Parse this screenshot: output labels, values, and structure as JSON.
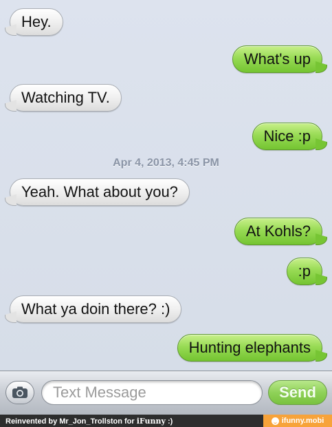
{
  "messages": [
    {
      "dir": "in",
      "text": "Hey."
    },
    {
      "dir": "out",
      "text": "What's up"
    },
    {
      "dir": "in",
      "text": "Watching TV."
    },
    {
      "dir": "out",
      "text": "Nice :p"
    },
    {
      "dir": "in",
      "text": "Yeah. What about you?"
    },
    {
      "dir": "out",
      "text": "At Kohls?"
    },
    {
      "dir": "out",
      "text": ":p"
    },
    {
      "dir": "in",
      "text": "What ya doin there? :)"
    },
    {
      "dir": "out",
      "text": "Hunting elephants"
    }
  ],
  "timestamp": "Apr 4, 2013, 4:45 PM",
  "input": {
    "placeholder": "Text Message",
    "value": "",
    "camera_icon": "camera-icon"
  },
  "send_label": "Send",
  "footer": {
    "credit_prefix": "Reinvented by Mr_Jon_Trollston for ",
    "credit_brand": "iFunny",
    "credit_suffix": " :)",
    "watermark": "ifunny.mobi"
  },
  "colors": {
    "incoming_bubble": "#eeeeee",
    "outgoing_bubble": "#98db55",
    "background": "#dbe2ec",
    "watermark_bg": "#f7a33a"
  }
}
